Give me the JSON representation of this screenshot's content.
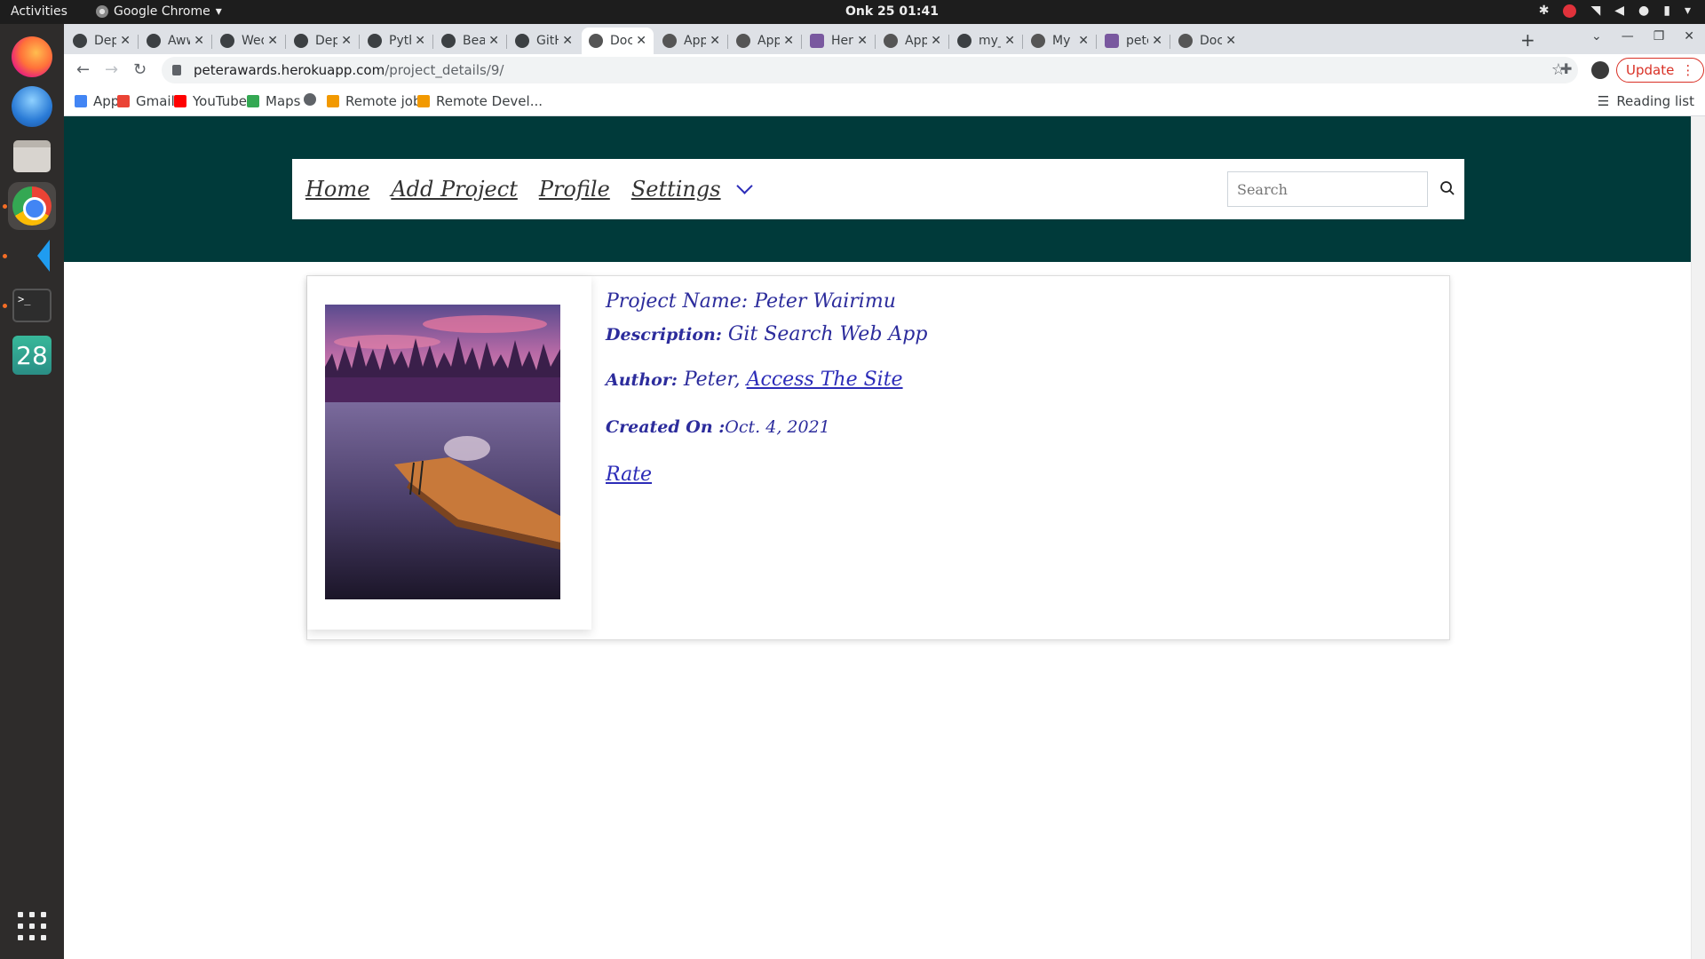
{
  "os": {
    "activities": "Activities",
    "app_name": "Google Chrome",
    "clock": "Onk 25  01:41",
    "dock_calendar_day": "28",
    "dock_terminal_prompt": ">_"
  },
  "browser": {
    "tabs": [
      {
        "title": "Deplo",
        "icon": "github-icon"
      },
      {
        "title": "Awwa",
        "icon": "github-icon"
      },
      {
        "title": "Wedn",
        "icon": "python-icon"
      },
      {
        "title": "Deplo",
        "icon": "github-icon"
      },
      {
        "title": "Pytho",
        "icon": "python-icon"
      },
      {
        "title": "Beaut",
        "icon": "bookmark-icon"
      },
      {
        "title": "GitHu",
        "icon": "github-icon"
      },
      {
        "title": "Docu",
        "icon": "globe-icon",
        "active": true
      },
      {
        "title": "Appli",
        "icon": "globe-icon"
      },
      {
        "title": "Appli",
        "icon": "globe-icon"
      },
      {
        "title": "Herol",
        "icon": "heroku-icon"
      },
      {
        "title": "Appli",
        "icon": "globe-icon"
      },
      {
        "title": "my_p",
        "icon": "github-icon"
      },
      {
        "title": "My po",
        "icon": "globe-icon"
      },
      {
        "title": "peter",
        "icon": "heroku-icon"
      },
      {
        "title": "Docu",
        "icon": "globe-icon"
      }
    ],
    "url_host": "peterawards.herokuapp.com",
    "url_path": "/project_details/9/",
    "update_label": "Update",
    "bookmarks": [
      {
        "label": "Apps",
        "icon": "apps-grid-icon"
      },
      {
        "label": "Gmail",
        "icon": "google-icon"
      },
      {
        "label": "YouTube",
        "icon": "youtube-icon"
      },
      {
        "label": "Maps",
        "icon": "maps-icon"
      },
      {
        "label": "",
        "icon": "globe-icon"
      },
      {
        "label": "Remote jobs",
        "icon": "remote-icon"
      },
      {
        "label": "Remote Devel...",
        "icon": "remote-icon"
      }
    ],
    "reading_list": "Reading list"
  },
  "page": {
    "nav": {
      "home": "Home",
      "add_project": "Add Project",
      "profile": "Profile",
      "settings": "Settings",
      "search_placeholder": "Search"
    },
    "project": {
      "name_label": "Project Name: ",
      "name_value": "Peter Wairimu",
      "description_label": "Description:",
      "description_value": " Git Search Web App",
      "author_label": "Author:",
      "author_value": " Peter, ",
      "site_link": "Access The Site",
      "created_label": "Created On :",
      "created_value": "Oct. 4, 2021",
      "rate": "Rate"
    },
    "colors": {
      "hero": "#003a3a",
      "accent_link": "#2c2cb8",
      "detail_text": "#2c2c9c"
    }
  }
}
